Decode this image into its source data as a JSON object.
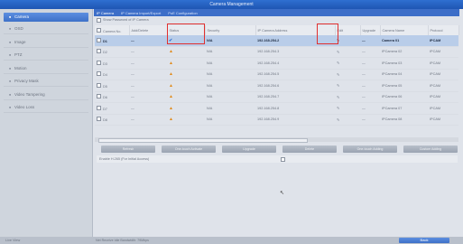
{
  "window": {
    "title": "Camera Management"
  },
  "sidebar": {
    "items": [
      {
        "label": "Camera",
        "icon": "camera-icon",
        "active": true
      },
      {
        "label": "OSD",
        "icon": "osd-icon"
      },
      {
        "label": "Image",
        "icon": "image-icon"
      },
      {
        "label": "PTZ",
        "icon": "ptz-icon"
      },
      {
        "label": "Motion",
        "icon": "motion-icon"
      },
      {
        "label": "Privacy Mask",
        "icon": "privacy-mask-icon"
      },
      {
        "label": "Video Tampering",
        "icon": "video-tampering-icon"
      },
      {
        "label": "Video Loss",
        "icon": "video-loss-icon"
      }
    ]
  },
  "tabs": [
    {
      "label": "IP Camera",
      "active": true
    },
    {
      "label": "IP Camera Import/Export"
    },
    {
      "label": "PoE Configuration"
    }
  ],
  "show_password_label": "Show Password of IP Camera",
  "table": {
    "headers": [
      "Camera No.",
      "Add/Delete",
      "Status",
      "Security",
      "IP Camera Address",
      "Edit",
      "Upgrade",
      "Camera Name",
      "Protocol"
    ],
    "rows": [
      {
        "no": "D1",
        "add": "—",
        "status": "online",
        "security": "N/A",
        "ip": "192.168.254.2",
        "edit": "✎",
        "upgrade": "—",
        "name": "Camera 01",
        "protocol": "IPCAM",
        "selected": true
      },
      {
        "no": "D2",
        "add": "—",
        "status": "warning",
        "security": "N/A",
        "ip": "192.168.254.3",
        "edit": "✎",
        "upgrade": "—",
        "name": "IPCamera 02",
        "protocol": "IPCAM"
      },
      {
        "no": "D3",
        "add": "—",
        "status": "warning",
        "security": "N/A",
        "ip": "192.168.254.4",
        "edit": "✎",
        "upgrade": "—",
        "name": "IPCamera 03",
        "protocol": "IPCAM"
      },
      {
        "no": "D4",
        "add": "—",
        "status": "warning",
        "security": "N/A",
        "ip": "192.168.254.5",
        "edit": "✎",
        "upgrade": "—",
        "name": "IPCamera 04",
        "protocol": "IPCAM"
      },
      {
        "no": "D5",
        "add": "—",
        "status": "warning",
        "security": "N/A",
        "ip": "192.168.254.6",
        "edit": "✎",
        "upgrade": "—",
        "name": "IPCamera 05",
        "protocol": "IPCAM"
      },
      {
        "no": "D6",
        "add": "—",
        "status": "warning",
        "security": "N/A",
        "ip": "192.168.254.7",
        "edit": "✎",
        "upgrade": "—",
        "name": "IPCamera 06",
        "protocol": "IPCAM"
      },
      {
        "no": "D7",
        "add": "—",
        "status": "warning",
        "security": "N/A",
        "ip": "192.168.254.8",
        "edit": "✎",
        "upgrade": "—",
        "name": "IPCamera 07",
        "protocol": "IPCAM"
      },
      {
        "no": "D8",
        "add": "—",
        "status": "warning",
        "security": "N/A",
        "ip": "192.168.254.9",
        "edit": "✎",
        "upgrade": "—",
        "name": "IPCamera 08",
        "protocol": "IPCAM"
      }
    ]
  },
  "buttons": [
    "Refresh",
    "One-touch Activate",
    "Upgrade",
    "Delete",
    "One-touch Adding",
    "Custom Adding"
  ],
  "h265_label": "Enable H.265 (For Initial Access)",
  "footer": {
    "live_view": "Live View",
    "bandwidth": "Net Receive Idle Bandwidth: 79Mbps",
    "back": "Back"
  },
  "colors": {
    "accent": "#2f6fd0",
    "highlight": "#e0302f",
    "warning": "#e08a1a"
  }
}
